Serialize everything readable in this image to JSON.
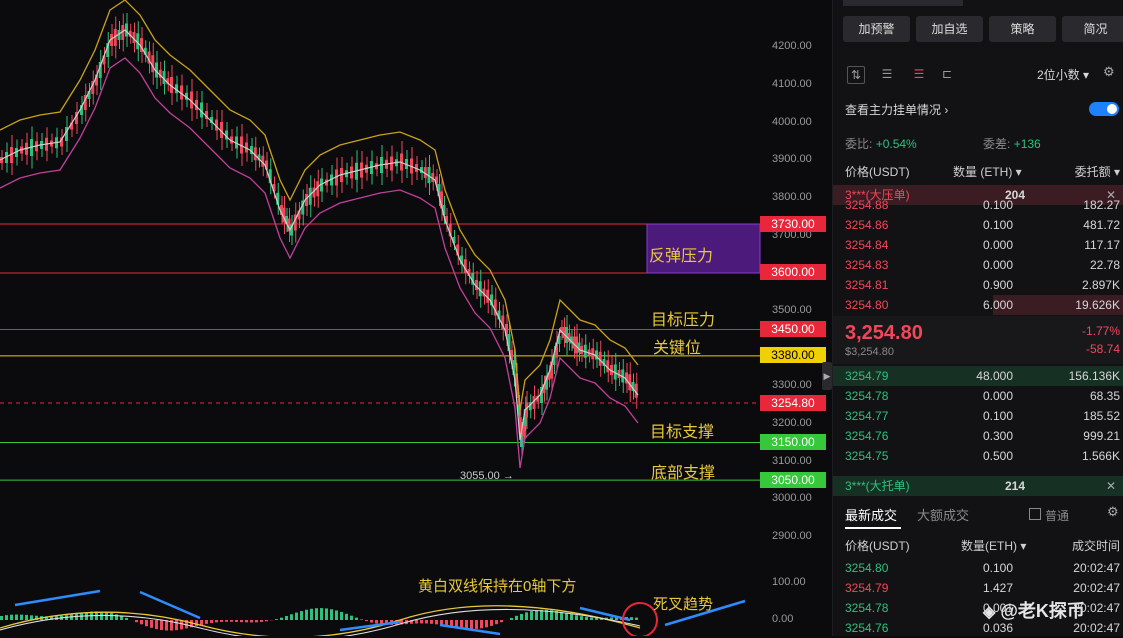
{
  "chart": {
    "y_axis": [
      "4200.00",
      "4100.00",
      "4000.00",
      "3900.00",
      "3800.00",
      "3700.00",
      "3500.00",
      "3300.00",
      "3200.00",
      "3100.00",
      "3000.00",
      "2900.00"
    ],
    "price_tags": [
      {
        "label": "3730.00",
        "color": "#e8283a"
      },
      {
        "label": "3600.00",
        "color": "#e8283a"
      },
      {
        "label": "3450.00",
        "color": "#e8283a"
      },
      {
        "label": "3380.00",
        "color": "#f0d000"
      },
      {
        "label": "3254.80",
        "color": "#e8283a"
      },
      {
        "label": "3150.00",
        "color": "#37c73a"
      },
      {
        "label": "3050.00",
        "color": "#37c73a"
      }
    ],
    "annotations": {
      "rebound_pressure": "反弹压力",
      "target_pressure": "目标压力",
      "key_level": "关键位",
      "target_support": "目标支撑",
      "bottom_support": "底部支撑",
      "low_label": "3055.00 →",
      "macd_note": "黄白双线保持在0轴下方",
      "dead_cross": "死叉趋势"
    },
    "macd_axis": [
      "100.00",
      "0.00"
    ]
  },
  "panel": {
    "buttons": [
      "加预警",
      "加自选",
      "策略",
      "简况"
    ],
    "decimals": "2位小数",
    "main_orders_title": "查看主力挂单情况",
    "ratio_label": "委比:",
    "ratio_value": "+0.54%",
    "diff_label": "委差:",
    "diff_value": "+136",
    "col_price": "价格(USDT)",
    "col_amount": "数量 (ETH)",
    "col_total": "委托额",
    "big_ask_label": "3***(大压单)",
    "big_ask_value": "204",
    "asks": [
      {
        "price": "3254.88",
        "amount": "0.100",
        "total": "182.27"
      },
      {
        "price": "3254.86",
        "amount": "0.100",
        "total": "481.72"
      },
      {
        "price": "3254.84",
        "amount": "0.000",
        "total": "117.17"
      },
      {
        "price": "3254.83",
        "amount": "0.000",
        "total": "22.78"
      },
      {
        "price": "3254.81",
        "amount": "0.900",
        "total": "2.897K"
      },
      {
        "price": "3254.80",
        "amount": "6.000",
        "total": "19.626K"
      }
    ],
    "last_price": "3,254.80",
    "last_price_sub": "$3,254.80",
    "change_pct": "-1.77%",
    "change_abs": "-58.74",
    "bids": [
      {
        "price": "3254.79",
        "amount": "48.000",
        "total": "156.136K"
      },
      {
        "price": "3254.78",
        "amount": "0.000",
        "total": "68.35"
      },
      {
        "price": "3254.77",
        "amount": "0.100",
        "total": "185.52"
      },
      {
        "price": "3254.76",
        "amount": "0.300",
        "total": "999.21"
      },
      {
        "price": "3254.75",
        "amount": "0.500",
        "total": "1.566K"
      }
    ],
    "big_bid_label": "3***(大托单)",
    "big_bid_value": "214",
    "trades_tab_latest": "最新成交",
    "trades_tab_large": "大额成交",
    "normal_label": "普通",
    "trades_col_price": "价格(USDT)",
    "trades_col_amount": "数量(ETH)",
    "trades_col_time": "成交时间",
    "trades": [
      {
        "price": "3254.80",
        "amount": "0.100",
        "time": "20:02:47",
        "color": "green"
      },
      {
        "price": "3254.79",
        "amount": "1.427",
        "time": "20:02:47",
        "color": "red"
      },
      {
        "price": "3254.78",
        "amount": "0.001",
        "time": "20:02:47",
        "color": "green"
      },
      {
        "price": "3254.76",
        "amount": "0.036",
        "time": "20:02:47",
        "color": "green"
      }
    ],
    "watermark": "@老K探币"
  }
}
